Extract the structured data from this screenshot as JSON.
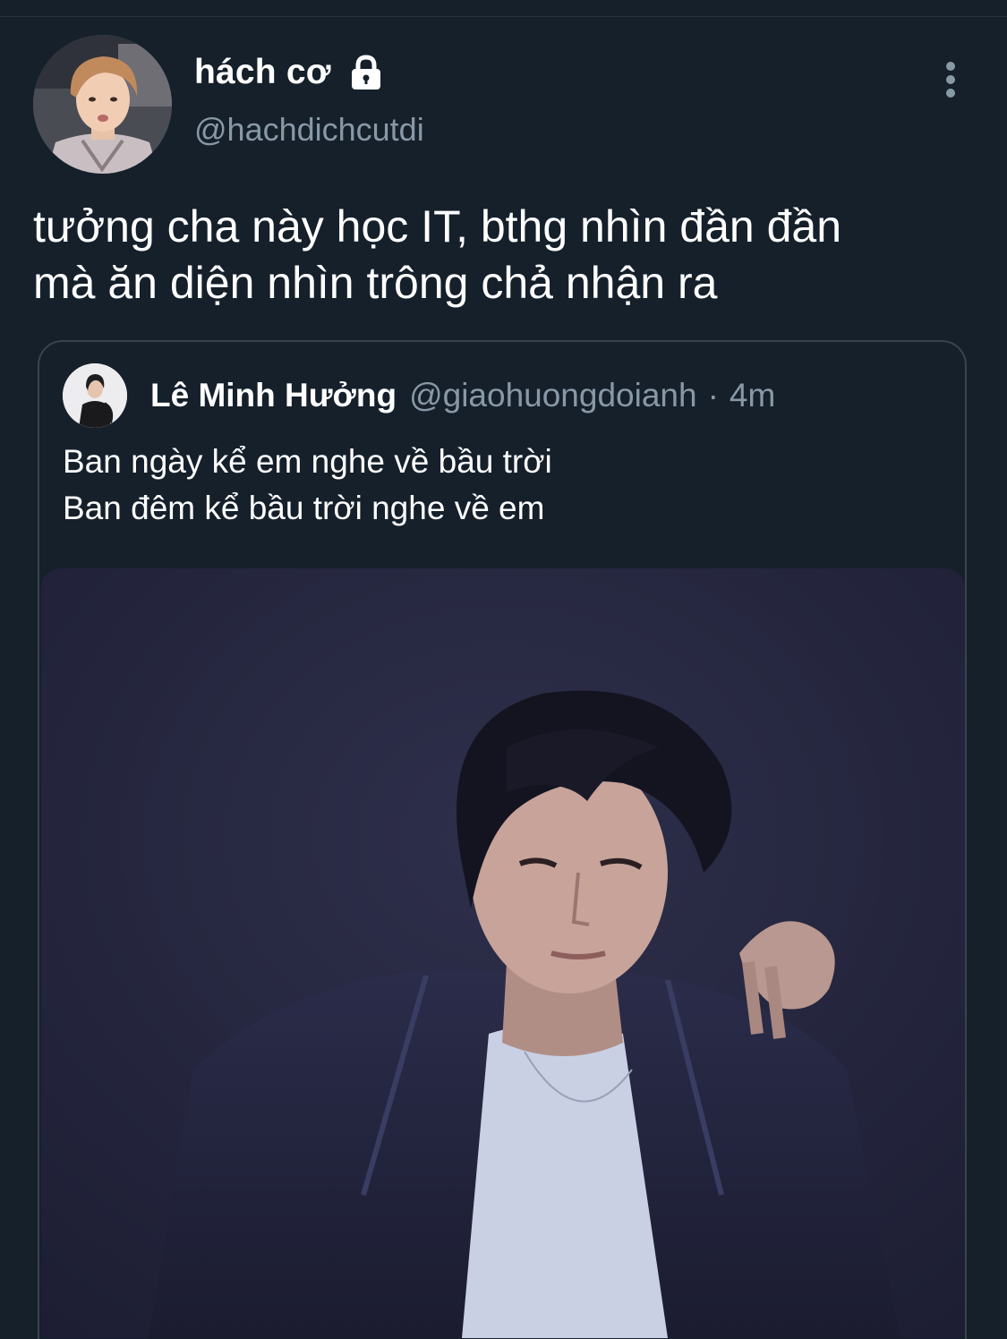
{
  "tweet": {
    "author": {
      "display_name": "hách cơ",
      "handle": "@hachdichcutdi",
      "protected_icon": "lock-icon",
      "avatar": "author-avatar"
    },
    "more_icon": "more-vertical-icon",
    "text": "tưởng cha này học IT, bthg nhìn đần đần\nmà ăn diện nhìn trông chả nhận ra"
  },
  "quoted_tweet": {
    "author": {
      "display_name": "Lê Minh Hưởng",
      "handle": "@giaohuongdoianh",
      "avatar": "quoted-author-avatar"
    },
    "separator": "·",
    "time": "4m",
    "lines": [
      "Ban ngày kể em nghe về bầu trời",
      "Ban đêm kể bầu trời nghe về em"
    ],
    "media": "quoted-photo"
  },
  "colors": {
    "background": "#15202b",
    "text_primary": "#ffffff",
    "text_secondary": "#8899a6",
    "border": "#38444d"
  }
}
